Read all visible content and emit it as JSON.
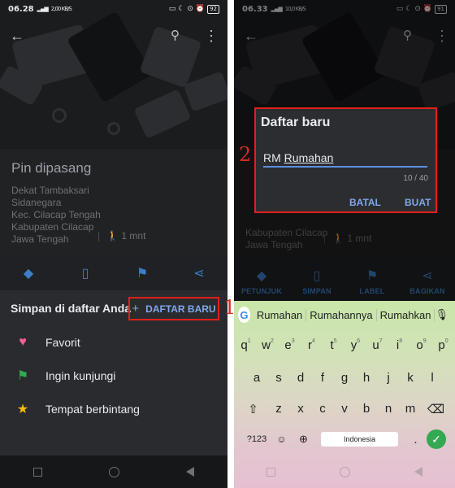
{
  "left": {
    "status": {
      "time": "06.28",
      "signal": "4G",
      "speed": "2,00 KB/S",
      "battery": "92"
    },
    "place": {
      "title": "Pin dipasang",
      "lines": [
        "Dekat Tambaksari",
        "Sidanegara",
        "Kec. Cilacap Tengah",
        "Kabupaten Cilacap",
        "Jawa Tengah"
      ],
      "walk": "1 mnt"
    },
    "save_header": "Simpan di daftar Anda",
    "new_list_button": "DAFTAR BARU",
    "marker_number": "1",
    "lists": [
      {
        "label": "Favorit",
        "icon": "heart-icon",
        "color": "#f06292"
      },
      {
        "label": "Ingin kunjungi",
        "icon": "flag-icon",
        "color": "#34a853"
      },
      {
        "label": "Tempat berbintang",
        "icon": "star-icon",
        "color": "#fbbc04"
      }
    ]
  },
  "right": {
    "status": {
      "time": "06.33",
      "signal": "4G",
      "speed": "10,0 KB/S",
      "battery": "91"
    },
    "place": {
      "lines": [
        "Kabupaten Cilacap",
        "Jawa Tengah"
      ],
      "walk": "1 mnt"
    },
    "actions": [
      {
        "label": "PETUNJUK",
        "icon": "directions-icon"
      },
      {
        "label": "SIMPAN",
        "icon": "bookmark-icon"
      },
      {
        "label": "LABEL",
        "icon": "flag-icon"
      },
      {
        "label": "BAGIKAN",
        "icon": "share-icon"
      }
    ],
    "marker_number": "2",
    "dialog": {
      "title": "Daftar baru",
      "input_prefix": "RM ",
      "input_word": "Rumahan",
      "counter": "10 / 40",
      "cancel": "BATAL",
      "create": "BUAT"
    },
    "keyboard": {
      "suggestions": [
        "Rumahan",
        "Rumahannya",
        "Rumahkan"
      ],
      "row1": [
        "q",
        "w",
        "e",
        "r",
        "t",
        "y",
        "u",
        "i",
        "o",
        "p"
      ],
      "row1_hints": [
        "1",
        "2",
        "3",
        "4",
        "5",
        "6",
        "7",
        "8",
        "9",
        "0"
      ],
      "row2": [
        "a",
        "s",
        "d",
        "f",
        "g",
        "h",
        "j",
        "k",
        "l"
      ],
      "row3": [
        "z",
        "x",
        "c",
        "v",
        "b",
        "n",
        "m"
      ],
      "symbols": "?123",
      "space_label": "Indonesia",
      "period": "."
    }
  },
  "colors": {
    "accent": "#3d7ec6",
    "highlight": "#e0201b",
    "dialog_link": "#7fa8ea"
  }
}
